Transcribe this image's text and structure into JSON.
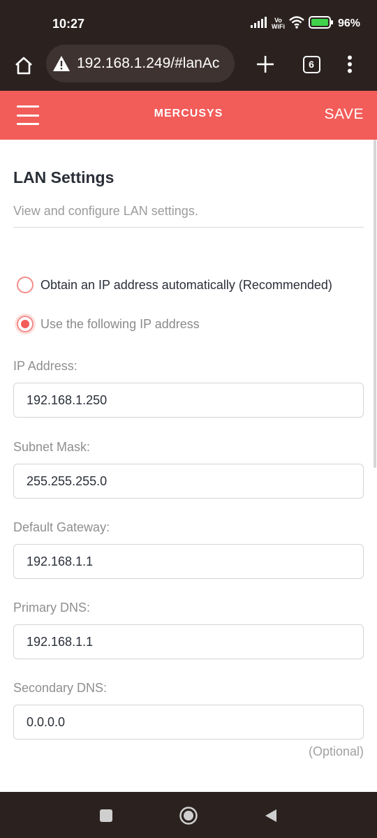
{
  "status": {
    "time": "10:27",
    "vowifi_top": "Vo",
    "vowifi_bottom": "WiFi",
    "battery_percent": "96%"
  },
  "browser": {
    "url": "192.168.1.249/#lanAc",
    "tab_count": "6"
  },
  "header": {
    "brand": "MERCUSYS",
    "save_label": "SAVE"
  },
  "page": {
    "title": "LAN Settings",
    "description": "View and configure LAN settings."
  },
  "ip_mode": {
    "options": [
      {
        "label": "Obtain an IP address automatically (Recommended)",
        "selected": false
      },
      {
        "label": "Use the following IP address",
        "selected": true
      }
    ]
  },
  "fields": {
    "ip_address": {
      "label": "IP Address:",
      "value": "192.168.1.250"
    },
    "subnet_mask": {
      "label": "Subnet Mask:",
      "value": "255.255.255.0"
    },
    "default_gateway": {
      "label": "Default Gateway:",
      "value": "192.168.1.1"
    },
    "primary_dns": {
      "label": "Primary DNS:",
      "value": "192.168.1.1"
    },
    "secondary_dns": {
      "label": "Secondary DNS:",
      "value": "0.0.0.0",
      "hint": "(Optional)"
    }
  },
  "colors": {
    "accent": "#f25c59",
    "system_bar": "#2b2220"
  }
}
